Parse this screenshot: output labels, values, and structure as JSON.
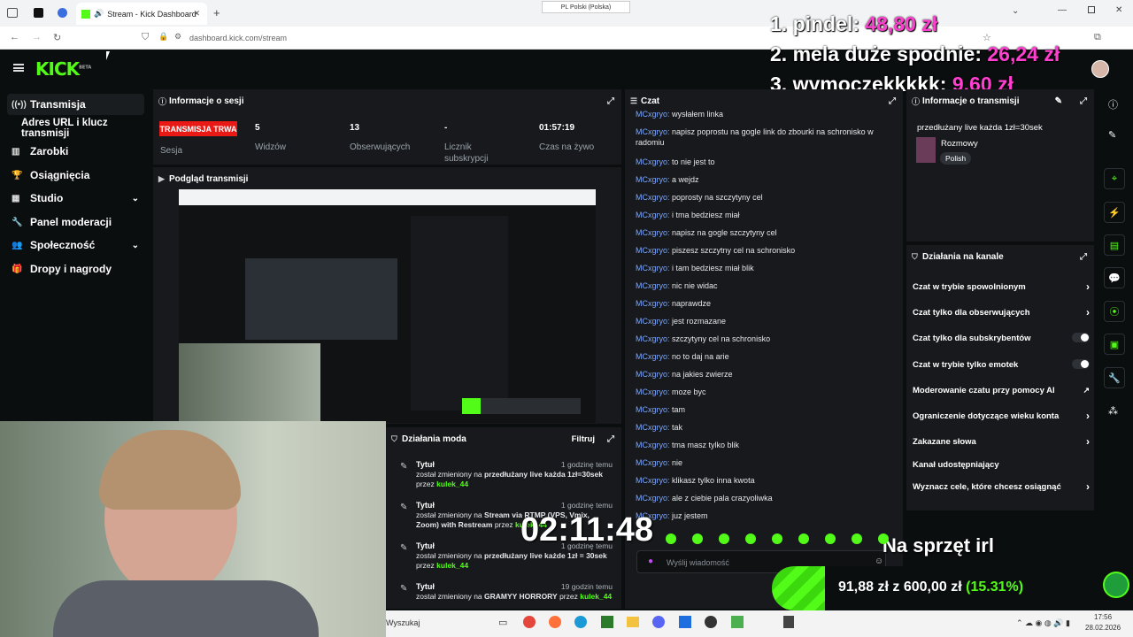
{
  "browser": {
    "tab_title": "Stream - Kick Dashboard",
    "url": "dashboard.kick.com/stream",
    "lang_pill": "PL Polski (Polska)"
  },
  "overlay": {
    "donors": [
      {
        "rank_name": "1. pindel:",
        "amount": "48,80 zł"
      },
      {
        "rank_name": "2. mela duże spodnie:",
        "amount": "26,24 zł"
      },
      {
        "rank_name": "3. wymoczekkkkk:",
        "amount": "9,60 zł"
      }
    ],
    "timer": "02:11:48",
    "goal_title": "Na sprzęt irl",
    "goal_progress": "91,88 zł",
    "goal_of": "z 600,00 zł",
    "goal_percent": "(15.31%)",
    "goal_fraction": 0.1531
  },
  "brand": {
    "logo": "KICK",
    "beta": "BETA"
  },
  "sidebar": {
    "items": [
      {
        "label": "Transmisja",
        "icon": "broadcast-icon"
      },
      {
        "label": "Adres URL i klucz transmisji"
      },
      {
        "label": "Zarobki",
        "icon": "chart-icon"
      },
      {
        "label": "Osiągnięcia",
        "icon": "trophy-icon"
      },
      {
        "label": "Studio",
        "icon": "studio-icon"
      },
      {
        "label": "Panel moderacji",
        "icon": "wrench-icon"
      },
      {
        "label": "Społeczność",
        "icon": "community-icon"
      },
      {
        "label": "Dropy i nagrody",
        "icon": "gift-icon"
      }
    ]
  },
  "session": {
    "title": "Informacje o sesji",
    "live_badge": "TRANSMISJA TRWA",
    "session_label": "Sesja",
    "viewers": "5",
    "viewers_label": "Widzów",
    "followers": "13",
    "followers_label": "Obserwujących",
    "subs": "-",
    "subs_label": "Licznik subskrypcji",
    "uptime": "01:57:19",
    "uptime_label": "Czas na żywo"
  },
  "preview": {
    "title": "Podgląd transmisji"
  },
  "modactions": {
    "title": "Działania moda",
    "filter": "Filtruj",
    "entries": [
      {
        "title": "Tytuł",
        "time": "1 godzinę temu",
        "text_a": "został zmieniony na",
        "value": "przedłużany live każda 1zł=30sek",
        "by": "przez",
        "user": "kulek_44"
      },
      {
        "title": "Tytuł",
        "time": "1 godzinę temu",
        "text_a": "został zmieniony na",
        "value": "Stream via RTMP (VPS, Vmix, Zoom) with Restream",
        "by": "przez",
        "user": "kulek_44"
      },
      {
        "title": "Tytuł",
        "time": "1 godzinę temu",
        "text_a": "został zmieniony na",
        "value": "przedłużany live każde 1zł = 30sek",
        "by": "przez",
        "user": "kulek_44"
      },
      {
        "title": "Tytuł",
        "time": "19 godzin temu",
        "text_a": "został zmieniony na",
        "value": "GRAMYY HORRORY",
        "by": "przez",
        "user": "kulek_44"
      }
    ]
  },
  "chat": {
    "title": "Czat",
    "placeholder": "Wyślij wiadomość",
    "messages": [
      {
        "user": "MCxgryo:",
        "text": "wysłałem linka"
      },
      {
        "user": "MCxgryo:",
        "text": "napisz poprostu na gogle link do zbourki na schronisko w radomiu"
      },
      {
        "user": "MCxgryo:",
        "text": "to nie jest to"
      },
      {
        "user": "MCxgryo:",
        "text": "a wejdz"
      },
      {
        "user": "MCxgryo:",
        "text": "poprosty na szczytyny cel"
      },
      {
        "user": "MCxgryo:",
        "text": "i tma bedziesz miał"
      },
      {
        "user": "MCxgryo:",
        "text": "napisz na gogle szczytyny cel"
      },
      {
        "user": "MCxgryo:",
        "text": "piszesz szczytny cel na schronisko"
      },
      {
        "user": "MCxgryo:",
        "text": "i tam bedziesz miał blik"
      },
      {
        "user": "MCxgryo:",
        "text": "nic nie widac"
      },
      {
        "user": "MCxgryo:",
        "text": "naprawdze"
      },
      {
        "user": "MCxgryo:",
        "text": "jest rozmazane"
      },
      {
        "user": "MCxgryo:",
        "text": "szczytyny cel na schronisko"
      },
      {
        "user": "MCxgryo:",
        "text": "no to daj na arie"
      },
      {
        "user": "MCxgryo:",
        "text": "na jakies zwierze"
      },
      {
        "user": "MCxgryo:",
        "text": "moze byc"
      },
      {
        "user": "MCxgryo:",
        "text": "tam"
      },
      {
        "user": "MCxgryo:",
        "text": "tak"
      },
      {
        "user": "MCxgryo:",
        "text": "tma masz tylko blik"
      },
      {
        "user": "MCxgryo:",
        "text": "nie"
      },
      {
        "user": "MCxgryo:",
        "text": "klikasz tylko inna kwota"
      },
      {
        "user": "MCxgryo:",
        "text": "ale z ciebie pala crazyoliwka"
      },
      {
        "user": "MCxgryo:",
        "text": "juz jestem"
      }
    ]
  },
  "stream_info": {
    "title": "Informacje o transmisji",
    "stream_title": "przedłużany live każda 1zł=30sek",
    "category": "Rozmowy",
    "language_tag": "Polish"
  },
  "channel_actions": {
    "title": "Działania na kanale",
    "items": [
      {
        "label": "Czat w trybie spowolnionym",
        "kind": "arrow"
      },
      {
        "label": "Czat tylko dla obserwujących",
        "kind": "arrow"
      },
      {
        "label": "Czat tylko dla subskrybentów",
        "kind": "toggle"
      },
      {
        "label": "Czat w trybie tylko emotek",
        "kind": "toggle"
      },
      {
        "label": "Moderowanie czatu przy pomocy AI",
        "kind": "external"
      },
      {
        "label": "Ograniczenie dotyczące wieku konta",
        "kind": "arrow"
      },
      {
        "label": "Zakazane słowa",
        "kind": "arrow"
      },
      {
        "label": "Kanał udostępniający",
        "kind": "none"
      },
      {
        "label": "Wyznacz cele, które chcesz osiągnąć",
        "kind": "arrow"
      }
    ]
  },
  "taskbar": {
    "search": "Wyszukaj",
    "time": "17:56",
    "date": "28.02.2026"
  },
  "colors": {
    "kick_green": "#53fc18",
    "live_red": "#e91916",
    "donor_pink": "#ff3fcf"
  }
}
